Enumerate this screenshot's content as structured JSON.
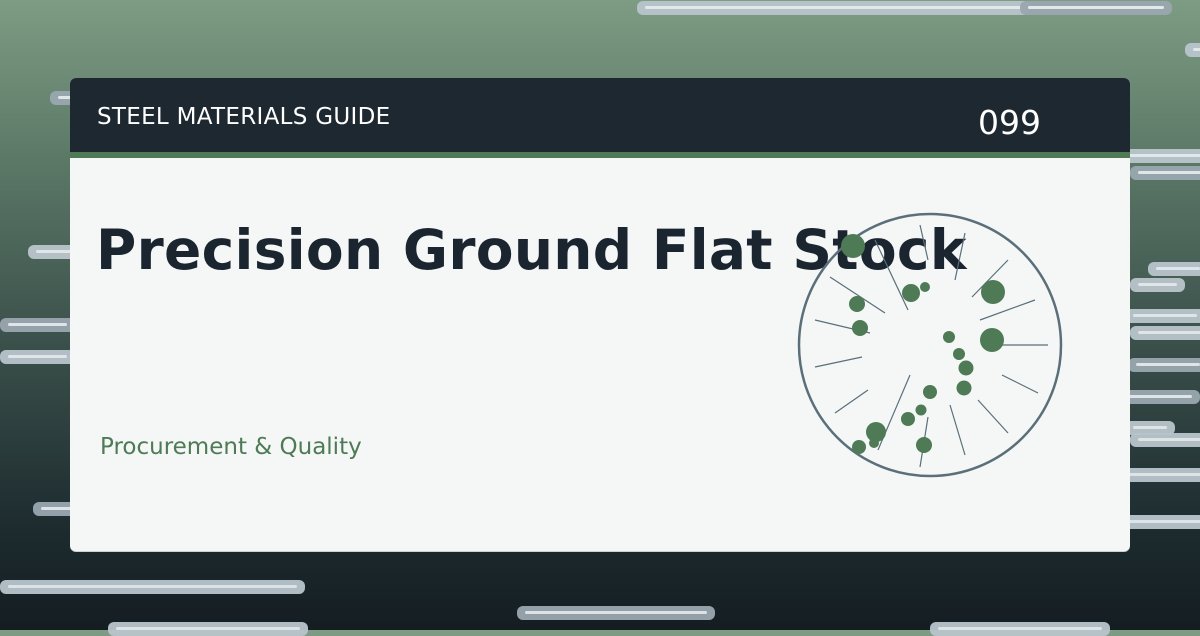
{
  "header": {
    "category": "STEEL MATERIALS GUIDE",
    "number": "099"
  },
  "main": {
    "title": "Precision Ground Flat Stock",
    "subtitle": "Procurement & Quality"
  },
  "colors": {
    "accent_green": "#4e7a55",
    "header_dark": "#1e2830",
    "card_bg": "#f4f7f6",
    "title_text": "#1b2530",
    "emblem_stroke": "#5b6f7a"
  },
  "icons": {
    "emblem": "steel-grain-disc-icon"
  }
}
